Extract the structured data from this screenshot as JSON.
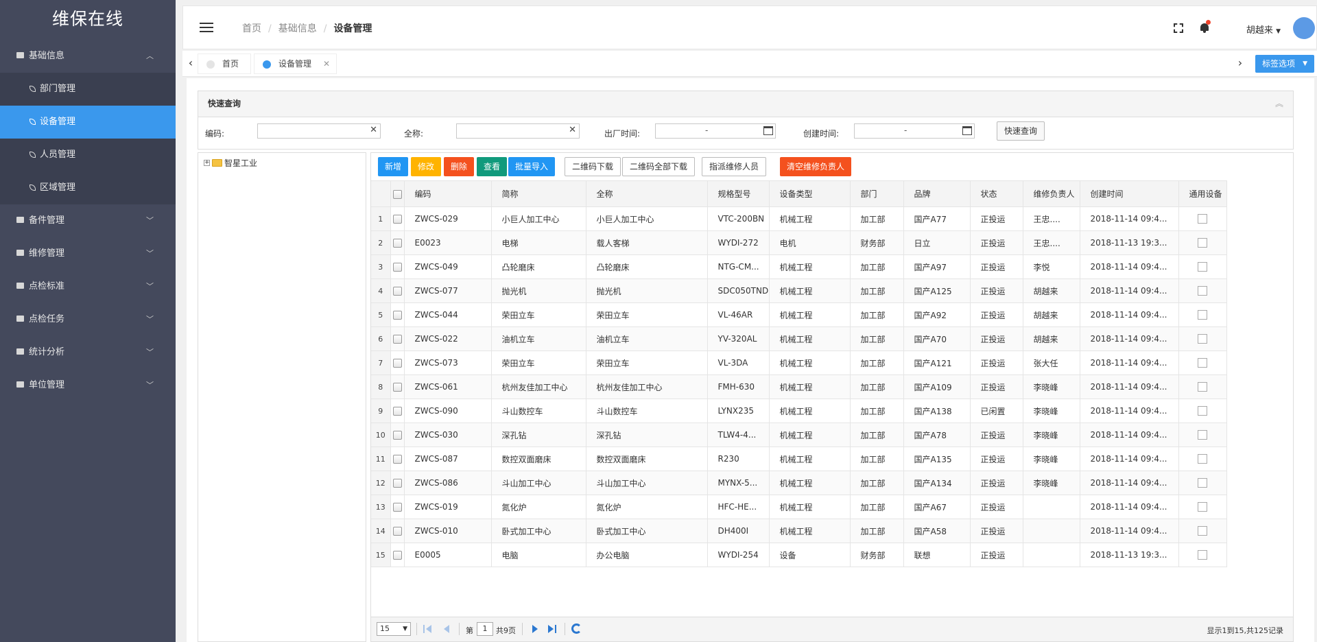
{
  "app": {
    "title": "维保在线"
  },
  "sidebar": {
    "groups": [
      {
        "label": "基础信息",
        "expanded": true,
        "items": [
          {
            "label": "部门管理"
          },
          {
            "label": "设备管理",
            "active": true
          },
          {
            "label": "人员管理"
          },
          {
            "label": "区域管理"
          }
        ]
      },
      {
        "label": "备件管理"
      },
      {
        "label": "维修管理"
      },
      {
        "label": "点检标准"
      },
      {
        "label": "点检任务"
      },
      {
        "label": "统计分析"
      },
      {
        "label": "单位管理"
      }
    ]
  },
  "header": {
    "breadcrumb": [
      "首页",
      "基础信息",
      "设备管理"
    ],
    "user_name": "胡越来",
    "accent": "#3a98ed"
  },
  "tabs": {
    "items": [
      {
        "label": "首页"
      },
      {
        "label": "设备管理",
        "active": true
      }
    ],
    "options_label": "标签选项"
  },
  "query": {
    "title": "快速查询",
    "fields": {
      "code_label": "编码:",
      "fullname_label": "全称:",
      "factory_label": "出厂时间:",
      "created_label": "创建时间:"
    },
    "date_separator": "-",
    "button": "快速查询"
  },
  "tree": {
    "root": "智星工业"
  },
  "toolbar": {
    "buttons": [
      {
        "label": "新增",
        "color": "#2196f3"
      },
      {
        "label": "修改",
        "color": "#ffb300"
      },
      {
        "label": "删除",
        "color": "#f4511e"
      },
      {
        "label": "查看",
        "color": "#109a7c"
      },
      {
        "label": "批量导入",
        "color": "#2196f3"
      },
      {
        "label": "二维码下载"
      },
      {
        "label": "二维码全部下载"
      },
      {
        "label": "指派维修人员"
      },
      {
        "label": "清空维修负责人",
        "color": "#f4511e"
      }
    ]
  },
  "grid": {
    "columns": [
      "编码",
      "简称",
      "全称",
      "规格型号",
      "设备类型",
      "部门",
      "品牌",
      "状态",
      "维修负责人",
      "创建时间",
      "通用设备"
    ],
    "rows": [
      [
        "1",
        "ZWCS-029",
        "小巨人加工中心",
        "小巨人加工中心",
        "VTC-200BN",
        "机械工程",
        "加工部",
        "国产A77",
        "正投运",
        "王忠....",
        "2018-11-14 09:4..."
      ],
      [
        "2",
        "E0023",
        "电梯",
        "载人客梯",
        "WYDI-272",
        "电机",
        "财务部",
        "日立",
        "正投运",
        "王忠....",
        "2018-11-13 19:3..."
      ],
      [
        "3",
        "ZWCS-049",
        "凸轮磨床",
        "凸轮磨床",
        "NTG-CM...",
        "机械工程",
        "加工部",
        "国产A97",
        "正投运",
        "李悦",
        "2018-11-14 09:4..."
      ],
      [
        "4",
        "ZWCS-077",
        "抛光机",
        "抛光机",
        "SDC050TND",
        "机械工程",
        "加工部",
        "国产A125",
        "正投运",
        "胡越来",
        "2018-11-14 09:4..."
      ],
      [
        "5",
        "ZWCS-044",
        "荣田立车",
        "荣田立车",
        "VL-46AR",
        "机械工程",
        "加工部",
        "国产A92",
        "正投运",
        "胡越来",
        "2018-11-14 09:4..."
      ],
      [
        "6",
        "ZWCS-022",
        "油机立车",
        "油机立车",
        "YV-320AL",
        "机械工程",
        "加工部",
        "国产A70",
        "正投运",
        "胡越来",
        "2018-11-14 09:4..."
      ],
      [
        "7",
        "ZWCS-073",
        "荣田立车",
        "荣田立车",
        "VL-3DA",
        "机械工程",
        "加工部",
        "国产A121",
        "正投运",
        "张大任",
        "2018-11-14 09:4..."
      ],
      [
        "8",
        "ZWCS-061",
        "杭州友佳加工中心",
        "杭州友佳加工中心",
        "FMH-630",
        "机械工程",
        "加工部",
        "国产A109",
        "正投运",
        "李晓峰",
        "2018-11-14 09:4..."
      ],
      [
        "9",
        "ZWCS-090",
        "斗山数控车",
        "斗山数控车",
        "LYNX235",
        "机械工程",
        "加工部",
        "国产A138",
        "已闲置",
        "李晓峰",
        "2018-11-14 09:4..."
      ],
      [
        "10",
        "ZWCS-030",
        "深孔钻",
        "深孔钻",
        "TLW4-4...",
        "机械工程",
        "加工部",
        "国产A78",
        "正投运",
        "李晓峰",
        "2018-11-14 09:4..."
      ],
      [
        "11",
        "ZWCS-087",
        "数控双面磨床",
        "数控双面磨床",
        "R230",
        "机械工程",
        "加工部",
        "国产A135",
        "正投运",
        "李晓峰",
        "2018-11-14 09:4..."
      ],
      [
        "12",
        "ZWCS-086",
        "斗山加工中心",
        "斗山加工中心",
        "MYNX-5...",
        "机械工程",
        "加工部",
        "国产A134",
        "正投运",
        "李晓峰",
        "2018-11-14 09:4..."
      ],
      [
        "13",
        "ZWCS-019",
        "氮化炉",
        "氮化炉",
        "HFC-HE...",
        "机械工程",
        "加工部",
        "国产A67",
        "正投运",
        "",
        "2018-11-14 09:4..."
      ],
      [
        "14",
        "ZWCS-010",
        "卧式加工中心",
        "卧式加工中心",
        "DH400I",
        "机械工程",
        "加工部",
        "国产A58",
        "正投运",
        "",
        "2018-11-14 09:4..."
      ],
      [
        "15",
        "E0005",
        "电脑",
        "办公电脑",
        "WYDI-254",
        "设备",
        "财务部",
        "联想",
        "正投运",
        "",
        "2018-11-13 19:3..."
      ]
    ]
  },
  "pager": {
    "page_size": "15",
    "page_prefix": "第",
    "page_value": "1",
    "page_suffix": "共9页",
    "info": "显示1到15,共125记录"
  }
}
